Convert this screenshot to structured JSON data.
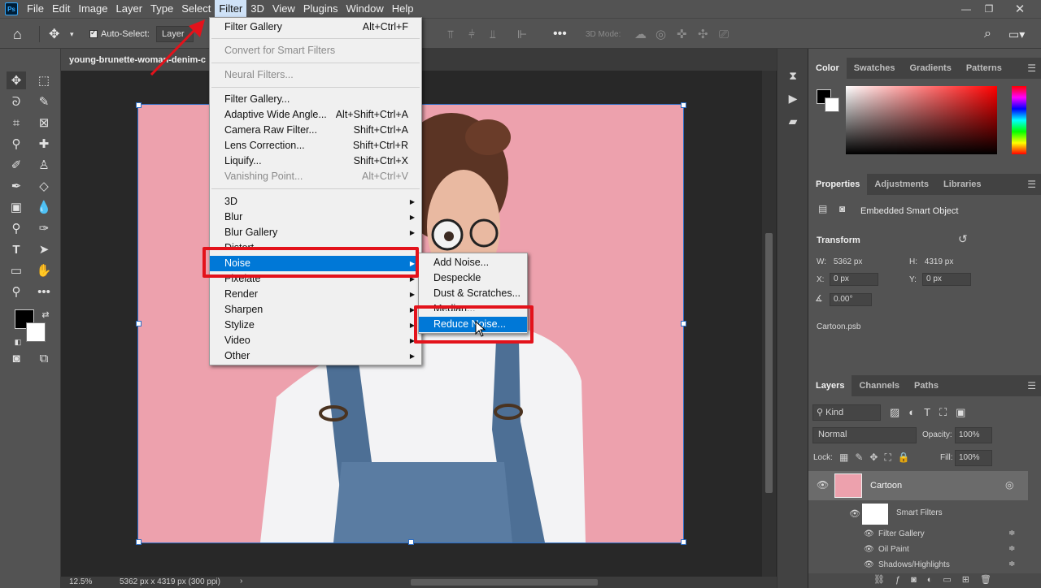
{
  "menubar": {
    "items": [
      "File",
      "Edit",
      "Image",
      "Layer",
      "Type",
      "Select",
      "Filter",
      "3D",
      "View",
      "Plugins",
      "Window",
      "Help"
    ],
    "active": "Filter"
  },
  "options": {
    "auto_select_label": "Auto-Select:",
    "auto_select_value": "Layer",
    "mode_3d_label": "3D Mode:"
  },
  "document": {
    "tab_title": "young-brunette-woman-denim-c"
  },
  "status": {
    "zoom": "12.5%",
    "dims": "5362 px x 4319 px (300 ppi)"
  },
  "filter_menu": {
    "items": [
      {
        "label": "Filter Gallery",
        "shortcut": "Alt+Ctrl+F"
      },
      {
        "label": "Convert for Smart Filters",
        "disabled": true
      },
      {
        "label": "Neural Filters...",
        "disabled": true
      },
      {
        "label": "Filter Gallery...",
        "shortcut": ""
      },
      {
        "label": "Adaptive Wide Angle...",
        "shortcut": "Alt+Shift+Ctrl+A"
      },
      {
        "label": "Camera Raw Filter...",
        "shortcut": "Shift+Ctrl+A"
      },
      {
        "label": "Lens Correction...",
        "shortcut": "Shift+Ctrl+R"
      },
      {
        "label": "Liquify...",
        "shortcut": "Shift+Ctrl+X"
      },
      {
        "label": "Vanishing Point...",
        "shortcut": "Alt+Ctrl+V",
        "disabled": true
      },
      {
        "label": "3D"
      },
      {
        "label": "Blur"
      },
      {
        "label": "Blur Gallery"
      },
      {
        "label": "Distort"
      },
      {
        "label": "Noise"
      },
      {
        "label": "Pixelate"
      },
      {
        "label": "Render"
      },
      {
        "label": "Sharpen"
      },
      {
        "label": "Stylize"
      },
      {
        "label": "Video"
      },
      {
        "label": "Other"
      }
    ]
  },
  "noise_submenu": {
    "items": [
      "Add Noise...",
      "Despeckle",
      "Dust & Scratches...",
      "Median...",
      "Reduce Noise..."
    ],
    "highlighted": "Reduce Noise..."
  },
  "color_panel": {
    "tabs": [
      "Color",
      "Swatches",
      "Gradients",
      "Patterns"
    ],
    "active": "Color",
    "hue_color": "#ff0000"
  },
  "properties_panel": {
    "tabs": [
      "Properties",
      "Adjustments",
      "Libraries"
    ],
    "active": "Properties",
    "object_type": "Embedded Smart Object",
    "transform_title": "Transform",
    "w_label": "W:",
    "w_value": "5362 px",
    "h_label": "H:",
    "h_value": "4319 px",
    "x_label": "X:",
    "x_value": "0 px",
    "y_label": "Y:",
    "y_value": "0 px",
    "angle_value": "0.00°",
    "file_name": "Cartoon.psb"
  },
  "layers_panel": {
    "tabs": [
      "Layers",
      "Channels",
      "Paths"
    ],
    "active": "Layers",
    "kind_label": "Kind",
    "blend_mode": "Normal",
    "opacity_label": "Opacity:",
    "opacity_value": "100%",
    "lock_label": "Lock:",
    "fill_label": "Fill:",
    "fill_value": "100%",
    "layer_name": "Cartoon",
    "smart_filters_label": "Smart Filters",
    "filters": [
      "Filter Gallery",
      "Oil Paint",
      "Shadows/Highlights"
    ]
  },
  "colors": {
    "accent": "#0078d7",
    "highlight_box": "#e3121b",
    "canvas_bg": "#eda1ad"
  }
}
